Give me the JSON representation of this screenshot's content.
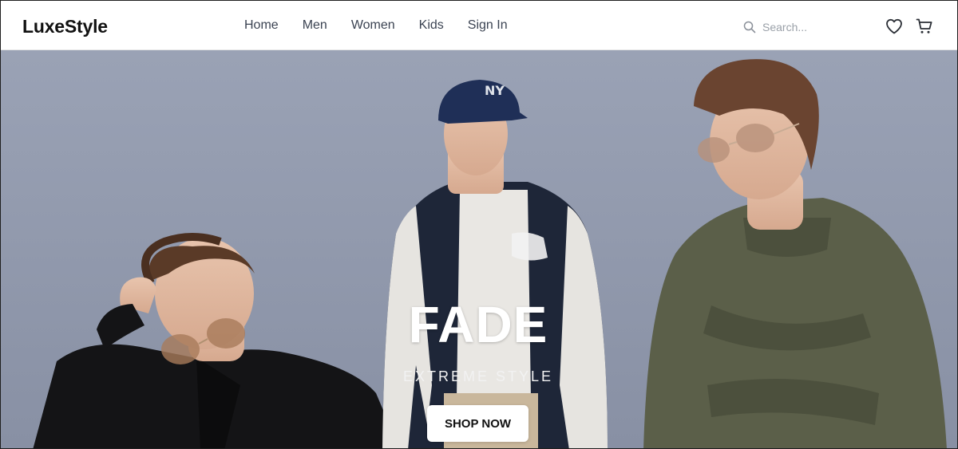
{
  "header": {
    "logo": "LuxeStyle",
    "nav": [
      {
        "label": "Home"
      },
      {
        "label": "Men"
      },
      {
        "label": "Women"
      },
      {
        "label": "Kids"
      },
      {
        "label": "Sign In"
      }
    ],
    "search": {
      "placeholder": "Search..."
    },
    "icons": [
      "search-icon",
      "heart-icon",
      "cart-icon"
    ]
  },
  "hero": {
    "title": "FADE",
    "subtitle": "EXTREME STYLE",
    "cta_label": "SHOP NOW",
    "image": {
      "depicts": [
        "man-black-shirt-sunglasses",
        "man-varsity-jacket-cap",
        "man-olive-jacket-sunglasses"
      ]
    }
  },
  "colors": {
    "background": "#8f98ac",
    "nav_text": "#3b4352",
    "logo_text": "#111111",
    "button_bg": "#ffffff"
  }
}
